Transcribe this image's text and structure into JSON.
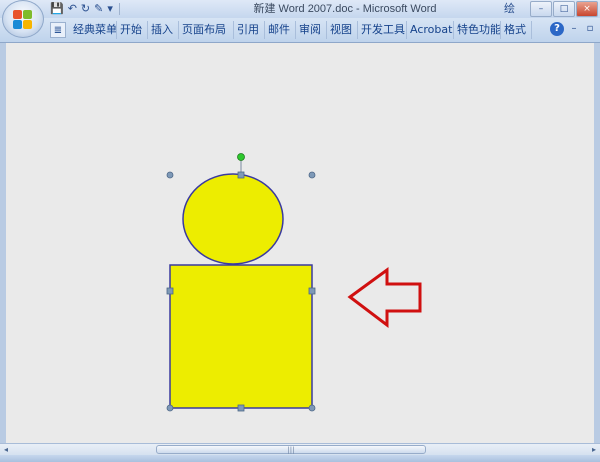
{
  "window": {
    "title": "新建 Word 2007.doc - Microsoft Word",
    "title_extra": "绘",
    "controls": {
      "minimize": "–",
      "maximize": "□",
      "close": "×"
    }
  },
  "quick_access": {
    "save_icon": "💾",
    "undo_icon": "↶",
    "redo_icon": "↻",
    "format_icon": "✎",
    "more_icon": "▾"
  },
  "ribbon": {
    "tab_icon": "≣",
    "tabs": [
      {
        "label": "经典菜单"
      },
      {
        "label": "开始"
      },
      {
        "label": "插入"
      },
      {
        "label": "页面布局"
      },
      {
        "label": "引用"
      },
      {
        "label": "邮件"
      },
      {
        "label": "审阅"
      },
      {
        "label": "视图"
      },
      {
        "label": "开发工具"
      },
      {
        "label": "Acrobat"
      },
      {
        "label": "特色功能"
      },
      {
        "label": "格式"
      }
    ],
    "help_label": "?",
    "minimize_ribbon": "–",
    "restore_window": "▫"
  },
  "drawing": {
    "fill_color": "#eded00",
    "stroke_color": "#3a3aa0",
    "arrow_color": "#d01010",
    "handle_color": "#7e99b7",
    "rotate_handle_color": "#2ec82e"
  },
  "scrollbar": {
    "left_arrow": "◂",
    "right_arrow": "▸",
    "thumb_grip": "|||"
  }
}
